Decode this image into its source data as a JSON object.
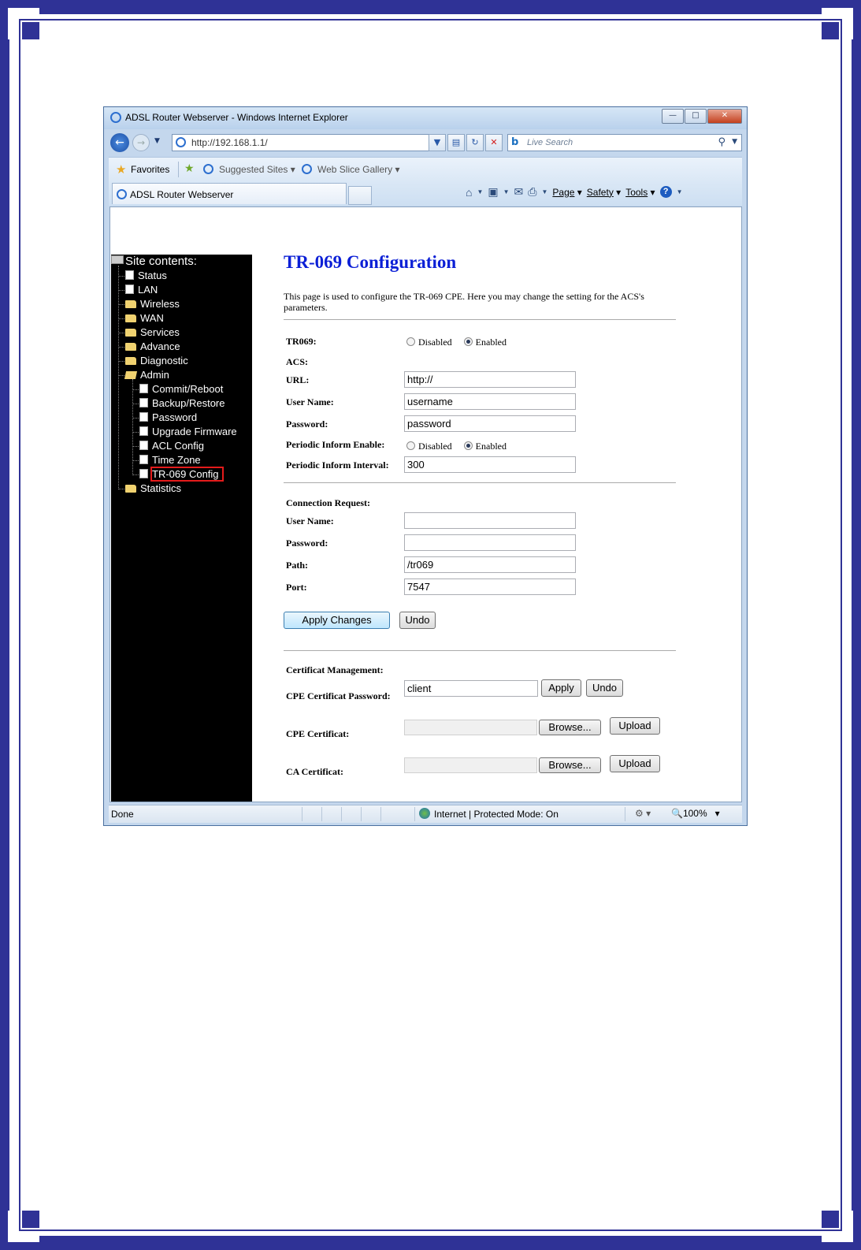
{
  "browser": {
    "window_title": "ADSL Router Webserver - Windows Internet Explorer",
    "address": "http://192.168.1.1/",
    "search_placeholder": "Live Search",
    "favorites_label": "Favorites",
    "suggested_sites": "Suggested Sites",
    "web_slice_gallery": "Web Slice Gallery",
    "tab_title": "ADSL Router Webserver",
    "commands": {
      "page": "Page",
      "safety": "Safety",
      "tools": "Tools"
    },
    "status": {
      "left": "Done",
      "zone": "Internet | Protected Mode: On",
      "zoom": "100%"
    }
  },
  "sidebar": {
    "root": "Site contents:",
    "items": [
      {
        "label": "Status",
        "type": "doc",
        "level": 1
      },
      {
        "label": "LAN",
        "type": "doc",
        "level": 1
      },
      {
        "label": "Wireless",
        "type": "folder",
        "level": 1
      },
      {
        "label": "WAN",
        "type": "folder",
        "level": 1
      },
      {
        "label": "Services",
        "type": "folder",
        "level": 1
      },
      {
        "label": "Advance",
        "type": "folder",
        "level": 1
      },
      {
        "label": "Diagnostic",
        "type": "folder",
        "level": 1
      },
      {
        "label": "Admin",
        "type": "folder-open",
        "level": 1
      },
      {
        "label": "Commit/Reboot",
        "type": "doc",
        "level": 2
      },
      {
        "label": "Backup/Restore",
        "type": "doc",
        "level": 2
      },
      {
        "label": "Password",
        "type": "doc",
        "level": 2
      },
      {
        "label": "Upgrade Firmware",
        "type": "doc",
        "level": 2
      },
      {
        "label": "ACL Config",
        "type": "doc",
        "level": 2
      },
      {
        "label": "Time Zone",
        "type": "doc",
        "level": 2
      },
      {
        "label": "TR-069 Config",
        "type": "doc",
        "level": 2,
        "selected": true
      },
      {
        "label": "Statistics",
        "type": "folder",
        "level": 1
      }
    ]
  },
  "page": {
    "title": "TR-069 Configuration",
    "description": "This page is used to configure the TR-069 CPE. Here you may change the setting for the ACS's parameters.",
    "tr069": {
      "label": "TR069:",
      "options": [
        "Disabled",
        "Enabled"
      ],
      "selected": "Enabled"
    },
    "acs": {
      "heading": "ACS:",
      "url_label": "URL:",
      "url": "http://",
      "username_label": "User Name:",
      "username": "username",
      "password_label": "Password:",
      "password": "password",
      "inform_enable_label": "Periodic Inform Enable:",
      "inform_options": [
        "Disabled",
        "Enabled"
      ],
      "inform_selected": "Enabled",
      "inform_interval_label": "Periodic Inform Interval:",
      "inform_interval": "300"
    },
    "connection_request": {
      "heading": "Connection Request:",
      "username_label": "User Name:",
      "username": "",
      "password_label": "Password:",
      "password": "",
      "path_label": "Path:",
      "path": "/tr069",
      "port_label": "Port:",
      "port": "7547"
    },
    "buttons": {
      "apply_changes": "Apply Changes",
      "undo": "Undo"
    },
    "certificate": {
      "heading": "Certificat Management:",
      "cpe_password_label": "CPE Certificat Password:",
      "cpe_password": "client",
      "apply": "Apply",
      "undo": "Undo",
      "cpe_cert_label": "CPE Certificat:",
      "ca_cert_label": "CA Certificat:",
      "browse": "Browse...",
      "upload": "Upload"
    }
  },
  "colors": {
    "frame": "#2f3296",
    "title": "#0b1fd6",
    "selection": "#e41b1b"
  }
}
